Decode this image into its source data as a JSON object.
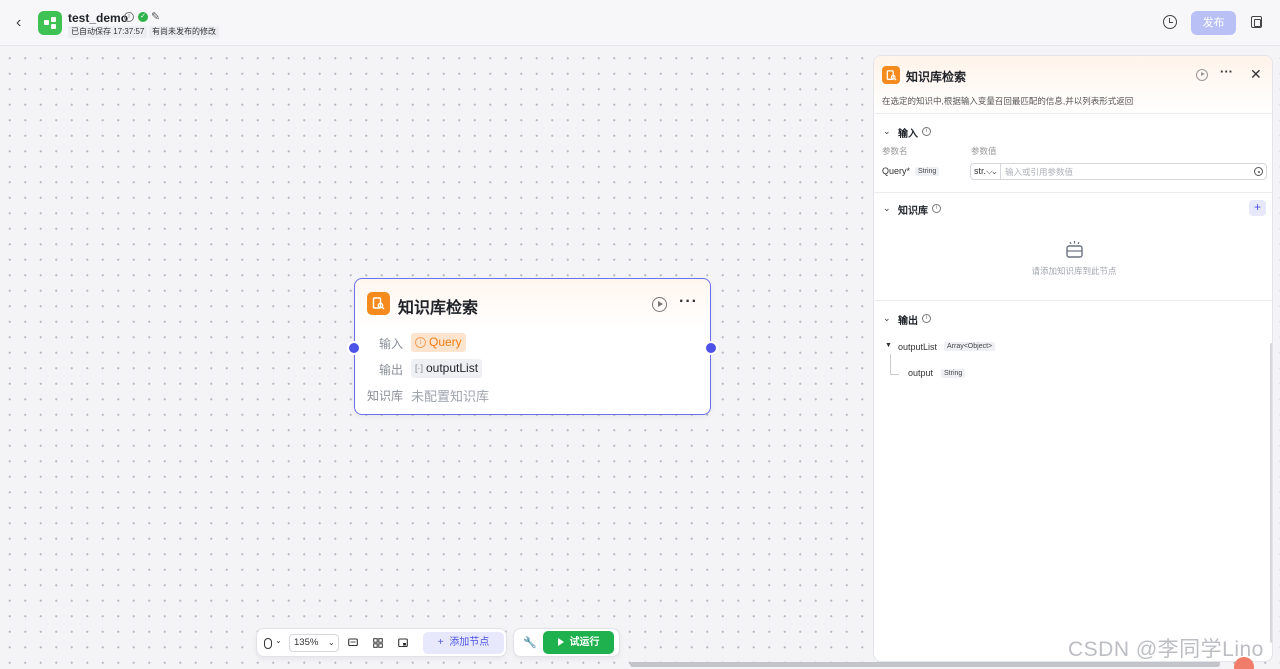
{
  "header": {
    "title": "test_demo",
    "autosave": "已自动保存 17:37:57",
    "unpublished": "有尚未发布的修改",
    "publish_label": "发布"
  },
  "node": {
    "title": "知识库检索",
    "input_label": "输入",
    "input_value": "Query",
    "output_label": "输出",
    "output_value": "outputList",
    "kb_label": "知识库",
    "kb_value": "未配置知识库"
  },
  "panel": {
    "title": "知识库检索",
    "description": "在选定的知识中,根据输入变量召回最匹配的信息,并以列表形式返回",
    "input": {
      "title": "输入",
      "param_name_header": "参数名",
      "param_value_header": "参数值",
      "param_name": "Query",
      "param_required": "*",
      "param_type": "String",
      "type_select": "str.",
      "value_placeholder": "输入或引用参数值"
    },
    "knowledge": {
      "title": "知识库",
      "empty_text": "请添加知识库到此节点"
    },
    "output": {
      "title": "输出",
      "items": [
        {
          "name": "outputList",
          "type": "Array<Object>"
        },
        {
          "name": "output",
          "type": "String"
        }
      ]
    }
  },
  "toolbar": {
    "zoom": "135%",
    "add_node": "添加节点",
    "test_run": "试运行"
  },
  "watermark": "CSDN @李同学Lino",
  "colors": {
    "accent": "#4d53e8",
    "node_orange": "#f58a1e",
    "run_green": "#1fb14e",
    "ok_green": "#2fb34a"
  }
}
